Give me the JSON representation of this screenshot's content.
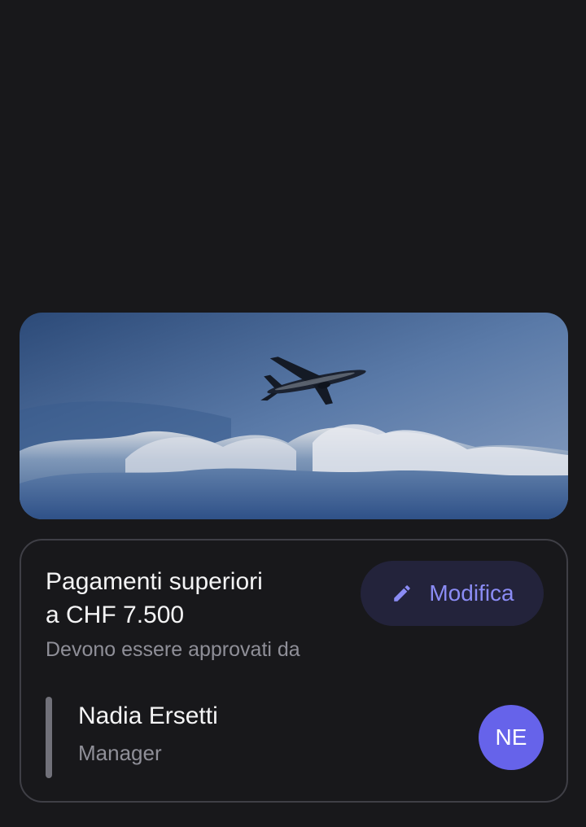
{
  "hero": {
    "image": "airplane-flying-over-clouds"
  },
  "rule": {
    "title_line1": "Pagamenti superiori",
    "title_line2": "a CHF 7.500",
    "subtitle": "Devono essere approvati da",
    "edit_label": "Modifica",
    "edit_icon": "pencil-icon"
  },
  "approver": {
    "name": "Nadia Ersetti",
    "role": "Manager",
    "initials": "NE"
  },
  "colors": {
    "background": "#18181b",
    "accent": "#8b8cf5",
    "avatar": "#6663ea",
    "button_bg": "#23233b"
  }
}
